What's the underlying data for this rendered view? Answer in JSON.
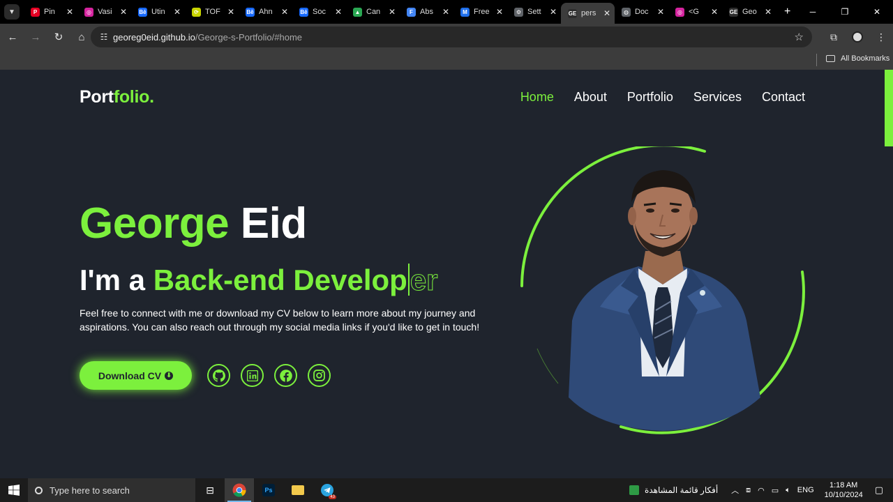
{
  "browser": {
    "tabs": [
      {
        "label": "Pin",
        "color": "#e60023",
        "glyph": "P"
      },
      {
        "label": "Vasi",
        "color": "#d6249f",
        "glyph": "◎"
      },
      {
        "label": "Utin",
        "color": "#1769ff",
        "glyph": "Bē"
      },
      {
        "label": "TOF",
        "color": "#c8d400",
        "glyph": "⟳"
      },
      {
        "label": "Ahn",
        "color": "#1769ff",
        "glyph": "Bē"
      },
      {
        "label": "Soc",
        "color": "#1769ff",
        "glyph": "Bē"
      },
      {
        "label": "Can",
        "color": "#2aa853",
        "glyph": "▲"
      },
      {
        "label": "Abs",
        "color": "#4285f4",
        "glyph": "F"
      },
      {
        "label": "Free",
        "color": "#1f6feb",
        "glyph": "M"
      },
      {
        "label": "Sett",
        "color": "#5f6368",
        "glyph": "⚙"
      },
      {
        "label": "pers",
        "color": "#2d2d2d",
        "glyph": "GE",
        "active": true
      },
      {
        "label": "Doc",
        "color": "#5f6368",
        "glyph": "◍"
      },
      {
        "label": "<G",
        "color": "#d6249f",
        "glyph": "◎"
      },
      {
        "label": "Geo",
        "color": "#2d2d2d",
        "glyph": "GE"
      }
    ],
    "url_host": "georeg0eid.github.io",
    "url_path": "/George-s-Portfolio/#home",
    "bookmarks_label": "All Bookmarks"
  },
  "site": {
    "logo_main": "Port",
    "logo_accent": "folio.",
    "nav": [
      "Home",
      "About",
      "Portfolio",
      "Services",
      "Contact"
    ],
    "active_nav": "Home",
    "name_first": "George",
    "name_last": "Eid",
    "role_prefix": "I'm a ",
    "role_typed": "Back-end Develop",
    "role_ghost": "er",
    "description": "Feel free to connect with me or download my CV below to learn more about my journey and aspirations. You can also reach out through my social media links if you'd like to get in touch!",
    "cv_button": "Download CV",
    "socials": [
      "github-icon",
      "linkedin-icon",
      "facebook-icon",
      "instagram-icon"
    ],
    "accent_color": "#7cf03d",
    "background_color": "#1f242d"
  },
  "taskbar": {
    "search_placeholder": "Type here to search",
    "news_text": "أفكار قائمة المشاهدة",
    "lang": "ENG",
    "time": "1:18 AM",
    "date": "10/10/2024",
    "telegram_badge": "43"
  }
}
